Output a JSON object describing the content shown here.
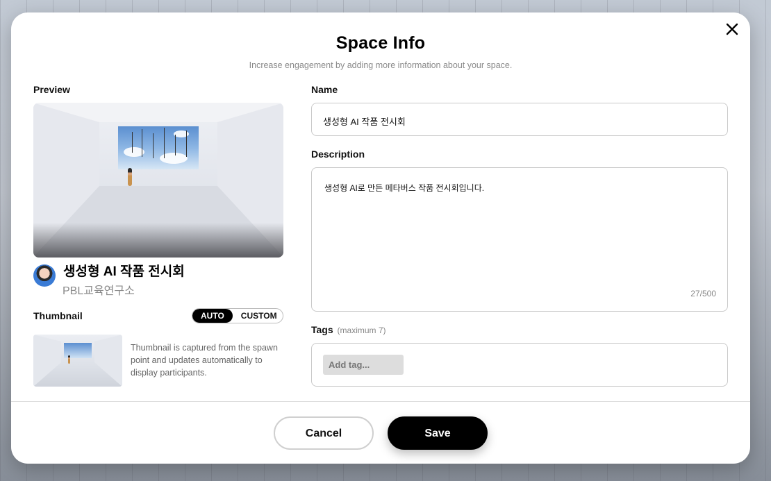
{
  "dialog": {
    "title": "Space Info",
    "subtitle": "Increase engagement by adding more information about your space."
  },
  "preview": {
    "label": "Preview",
    "space_name": "생성형 AI 작품 전시회",
    "owner": "PBL교육연구소"
  },
  "thumbnail": {
    "label": "Thumbnail",
    "options": [
      "AUTO",
      "CUSTOM"
    ],
    "selected": "AUTO",
    "description": "Thumbnail is captured from the spawn point and updates automatically to display participants."
  },
  "name_field": {
    "label": "Name",
    "value": "생성형 AI 작품 전시회"
  },
  "description_field": {
    "label": "Description",
    "value": "생성형 AI로 만든 메타버스 작품 전시회입니다.",
    "counter": "27/500"
  },
  "tags_field": {
    "label": "Tags",
    "hint": "(maximum 7)",
    "placeholder": "Add tag..."
  },
  "footer": {
    "cancel_label": "Cancel",
    "save_label": "Save"
  },
  "icons": {
    "close": "close-icon"
  },
  "colors": {
    "primary": "#000000",
    "muted_text": "#8a8a8a"
  }
}
